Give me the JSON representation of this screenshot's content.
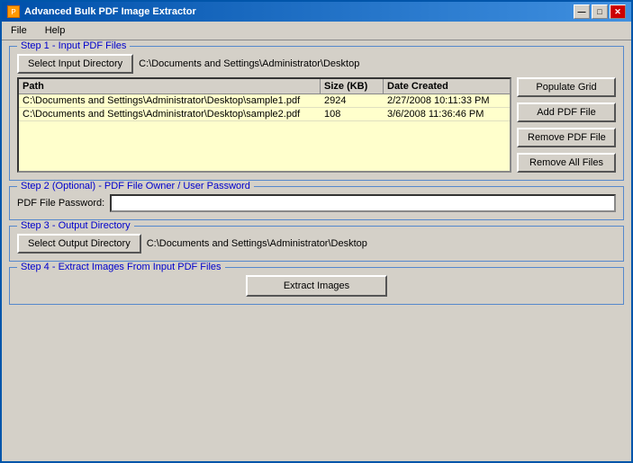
{
  "window": {
    "title": "Advanced Bulk PDF Image Extractor",
    "icon": "pdf-icon"
  },
  "titleButtons": {
    "minimize": "—",
    "maximize": "□",
    "close": "✕"
  },
  "menu": {
    "items": [
      {
        "label": "File"
      },
      {
        "label": "Help"
      }
    ]
  },
  "step1": {
    "legend": "Step 1 - Input PDF Files",
    "selectButton": "Select Input Directory",
    "inputPath": "C:\\Documents and Settings\\Administrator\\Desktop",
    "gridColumns": {
      "path": "Path",
      "size": "Size (KB)",
      "date": "Date Created"
    },
    "files": [
      {
        "path": "C:\\Documents and Settings\\Administrator\\Desktop\\sample1.pdf",
        "size": "2924",
        "date": "2/27/2008 10:11:33 PM"
      },
      {
        "path": "C:\\Documents and Settings\\Administrator\\Desktop\\sample2.pdf",
        "size": "108",
        "date": "3/6/2008 11:36:46 PM"
      }
    ],
    "populateGrid": "Populate Grid",
    "addPDF": "Add PDF File",
    "removePDF": "Remove PDF File",
    "removeAll": "Remove All Files"
  },
  "step2": {
    "legend": "Step 2 (Optional) - PDF File Owner / User Password",
    "passwordLabel": "PDF File Password:",
    "passwordValue": ""
  },
  "step3": {
    "legend": "Step 3 - Output Directory",
    "selectButton": "Select Output Directory",
    "outputPath": "C:\\Documents and Settings\\Administrator\\Desktop"
  },
  "step4": {
    "legend": "Step 4 - Extract Images From Input PDF Files",
    "extractButton": "Extract Images"
  }
}
